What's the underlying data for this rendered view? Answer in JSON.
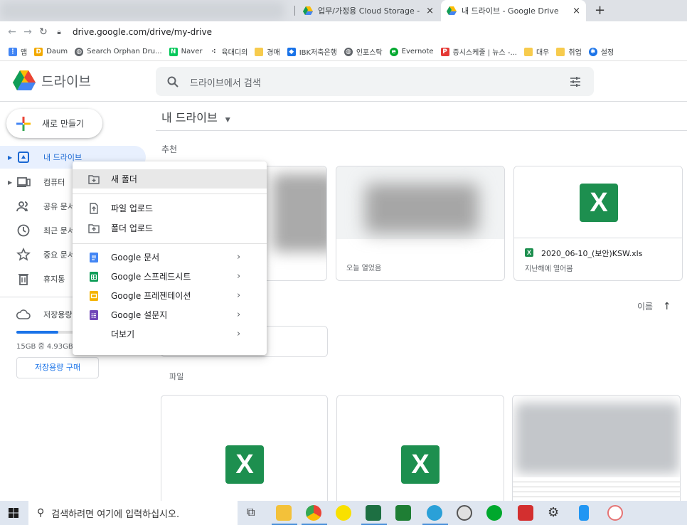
{
  "browser": {
    "tabs": [
      {
        "title": "업무/가정용 Cloud Storage - Go",
        "close": "×"
      },
      {
        "title": "내 드라이브 - Google Drive",
        "close": "×"
      }
    ],
    "new_tab": "+",
    "url": "drive.google.com/drive/my-drive",
    "bookmarks": [
      {
        "label": "앱",
        "icon": "apps-grid-icon",
        "color": "#4285f4"
      },
      {
        "label": "Daum",
        "icon": "daum-icon",
        "color": "#f2a900"
      },
      {
        "label": "Search Orphan Dru...",
        "icon": "globe-icon",
        "color": "#5f6368"
      },
      {
        "label": "Naver",
        "icon": "naver-icon",
        "color": "#03c75a"
      },
      {
        "label": "육대디의",
        "icon": "dots-icon",
        "color": "#202124"
      },
      {
        "label": "경매",
        "icon": "folder-icon",
        "color": "#f7cb4d"
      },
      {
        "label": "IBK저축은행",
        "icon": "ibk-icon",
        "color": "#1a73e8"
      },
      {
        "label": "인포스탁",
        "icon": "globe-icon",
        "color": "#5f6368"
      },
      {
        "label": "Evernote",
        "icon": "evernote-icon",
        "color": "#00a82d"
      },
      {
        "label": "증시스케줄 | 뉴스 -...",
        "icon": "p-icon",
        "color": "#e53935"
      },
      {
        "label": "대우",
        "icon": "folder-icon",
        "color": "#f7cb4d"
      },
      {
        "label": "취업",
        "icon": "folder-icon",
        "color": "#f7cb4d"
      },
      {
        "label": "설정",
        "icon": "gear-icon",
        "color": "#1a73e8"
      }
    ]
  },
  "drive": {
    "title": "드라이브",
    "search_placeholder": "드라이브에서 검색",
    "new_button": "새로 만들기",
    "sidebar": [
      {
        "label": "내 드라이브",
        "icon": "my-drive-icon",
        "active": true
      },
      {
        "label": "컴퓨터",
        "icon": "computer-icon"
      },
      {
        "label": "공유 문서",
        "icon": "shared-icon"
      },
      {
        "label": "최근 문서",
        "icon": "clock-icon"
      },
      {
        "label": "중요 문서",
        "icon": "star-icon"
      },
      {
        "label": "휴지통",
        "icon": "trash-icon"
      }
    ],
    "storage_label": "저장용량",
    "storage_used_text": "15GB 중 4.93GB",
    "storage_used_fraction": 0.33,
    "buy_storage": "저장용량 구매",
    "breadcrumb": "내 드라이브",
    "suggested_label": "추천",
    "suggested": [
      {
        "name": "",
        "sub": ""
      },
      {
        "name": "",
        "sub": "오늘 열었음"
      },
      {
        "name": "2020_06-10_(보안)KSW.xls",
        "sub": "지난해에 열어봄"
      }
    ],
    "sort_label": "이름",
    "files_label": "파일"
  },
  "context_menu": {
    "items": [
      {
        "label": "새 폴더",
        "icon": "new-folder-icon"
      },
      {
        "label": "파일 업로드",
        "icon": "file-upload-icon"
      },
      {
        "label": "폴더 업로드",
        "icon": "folder-upload-icon"
      },
      {
        "label": "Google 문서",
        "icon": "docs-icon",
        "color": "#4285f4"
      },
      {
        "label": "Google 스프레드시트",
        "icon": "sheets-icon",
        "color": "#0f9d58"
      },
      {
        "label": "Google 프레젠테이션",
        "icon": "slides-icon",
        "color": "#f4b400"
      },
      {
        "label": "Google 설문지",
        "icon": "forms-icon",
        "color": "#7248b9"
      },
      {
        "label": "더보기",
        "icon": ""
      }
    ],
    "chevron": "›"
  },
  "taskbar": {
    "search_placeholder": "검색하려면 여기에 입력하십시오."
  }
}
